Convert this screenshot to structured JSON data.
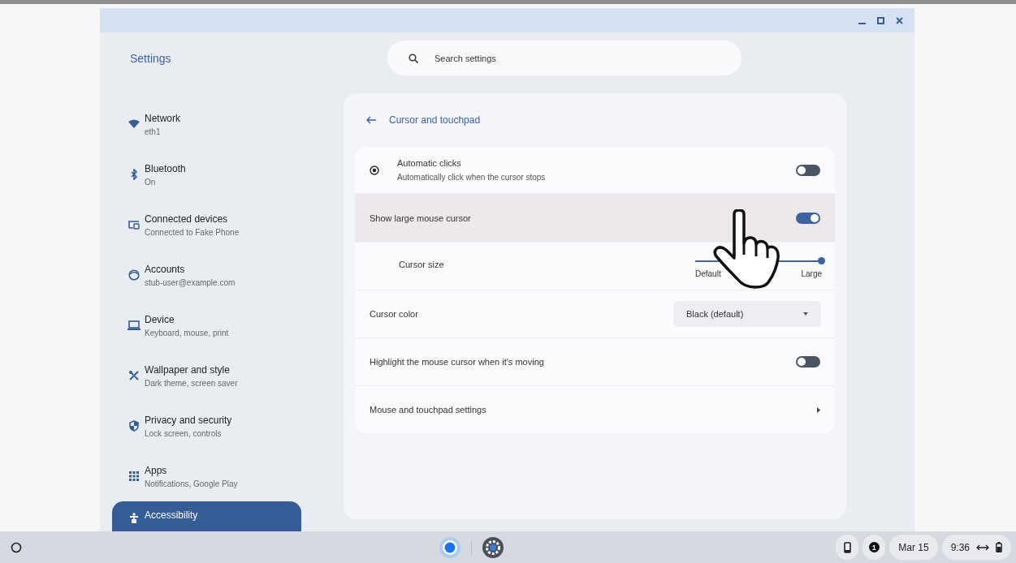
{
  "window": {
    "title": "Settings"
  },
  "search": {
    "placeholder": "Search settings"
  },
  "sidebar": {
    "items": [
      {
        "label": "Network",
        "sublabel": "eth1",
        "selected": false
      },
      {
        "label": "Bluetooth",
        "sublabel": "On",
        "selected": false
      },
      {
        "label": "Connected devices",
        "sublabel": "Connected to Fake Phone",
        "selected": false
      },
      {
        "label": "Accounts",
        "sublabel": "stub-user@example.com",
        "selected": false
      },
      {
        "label": "Device",
        "sublabel": "Keyboard, mouse, print",
        "selected": false
      },
      {
        "label": "Wallpaper and style",
        "sublabel": "Dark theme, screen saver",
        "selected": false
      },
      {
        "label": "Privacy and security",
        "sublabel": "Lock screen, controls",
        "selected": false
      },
      {
        "label": "Apps",
        "sublabel": "Notifications, Google Play",
        "selected": false
      },
      {
        "label": "Accessibility",
        "selected": true
      }
    ]
  },
  "page": {
    "title": "Cursor and touchpad",
    "rows": [
      {
        "kind": "toggle",
        "label": "Automatic clicks",
        "description": "Automatically click when the cursor stops",
        "on": false,
        "hovered": false
      },
      {
        "kind": "toggle",
        "label": "Show large mouse cursor",
        "on": true,
        "hovered": true
      },
      {
        "kind": "slider",
        "label": "Cursor size",
        "level": 1,
        "min_label": "Default",
        "max_label": "Large",
        "hovered": false
      },
      {
        "kind": "dropdown",
        "label": "Cursor color",
        "value": "Black (default)",
        "hovered": false
      },
      {
        "kind": "toggle",
        "label": "Highlight the mouse cursor when it's moving",
        "on": false,
        "hovered": false
      },
      {
        "kind": "link",
        "label": "Mouse and touchpad settings",
        "hovered": false
      }
    ]
  },
  "shelf": {
    "notification_count": "1",
    "date": "Mar 15",
    "time": "9:36"
  }
}
